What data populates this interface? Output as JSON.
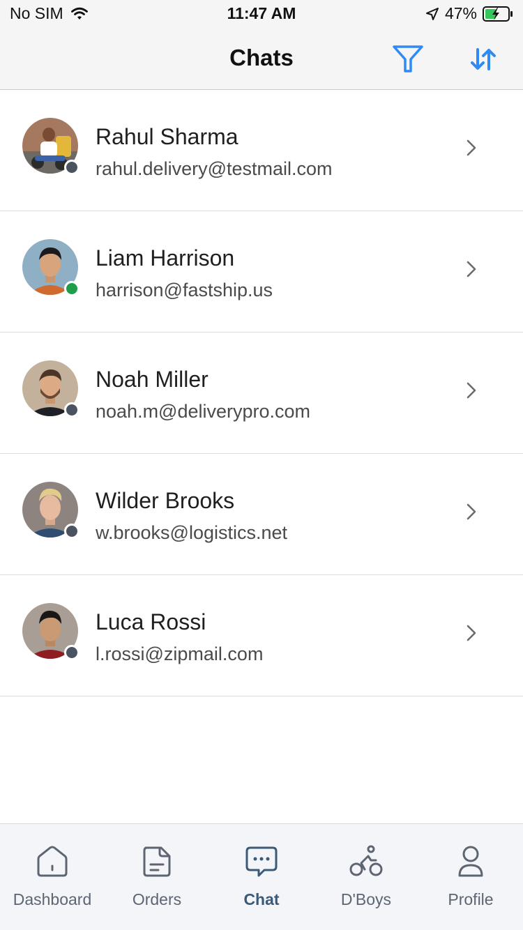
{
  "status_bar": {
    "carrier": "No SIM",
    "time": "11:47 AM",
    "battery": "47%"
  },
  "nav": {
    "title": "Chats",
    "filter_icon": "filter-icon",
    "sort_icon": "sort-icon"
  },
  "colors": {
    "accent": "#2f8af5",
    "online": "#1e9e4a",
    "offline": "#4b5361",
    "tab_active": "#3a5a78",
    "tab_inactive": "#5d6573"
  },
  "chats": [
    {
      "name": "Rahul Sharma",
      "email": "rahul.delivery@testmail.com",
      "status": "offline"
    },
    {
      "name": "Liam Harrison",
      "email": "harrison@fastship.us",
      "status": "online"
    },
    {
      "name": "Noah Miller",
      "email": "noah.m@deliverypro.com",
      "status": "offline"
    },
    {
      "name": "Wilder Brooks",
      "email": "w.brooks@logistics.net",
      "status": "offline"
    },
    {
      "name": "Luca Rossi",
      "email": "l.rossi@zipmail.com",
      "status": "offline"
    }
  ],
  "tabs": [
    {
      "label": "Dashboard",
      "icon": "home-icon",
      "active": false
    },
    {
      "label": "Orders",
      "icon": "document-icon",
      "active": false
    },
    {
      "label": "Chat",
      "icon": "chat-bubble-icon",
      "active": true
    },
    {
      "label": "D'Boys",
      "icon": "bicycle-rider-icon",
      "active": false
    },
    {
      "label": "Profile",
      "icon": "person-icon",
      "active": false
    }
  ]
}
